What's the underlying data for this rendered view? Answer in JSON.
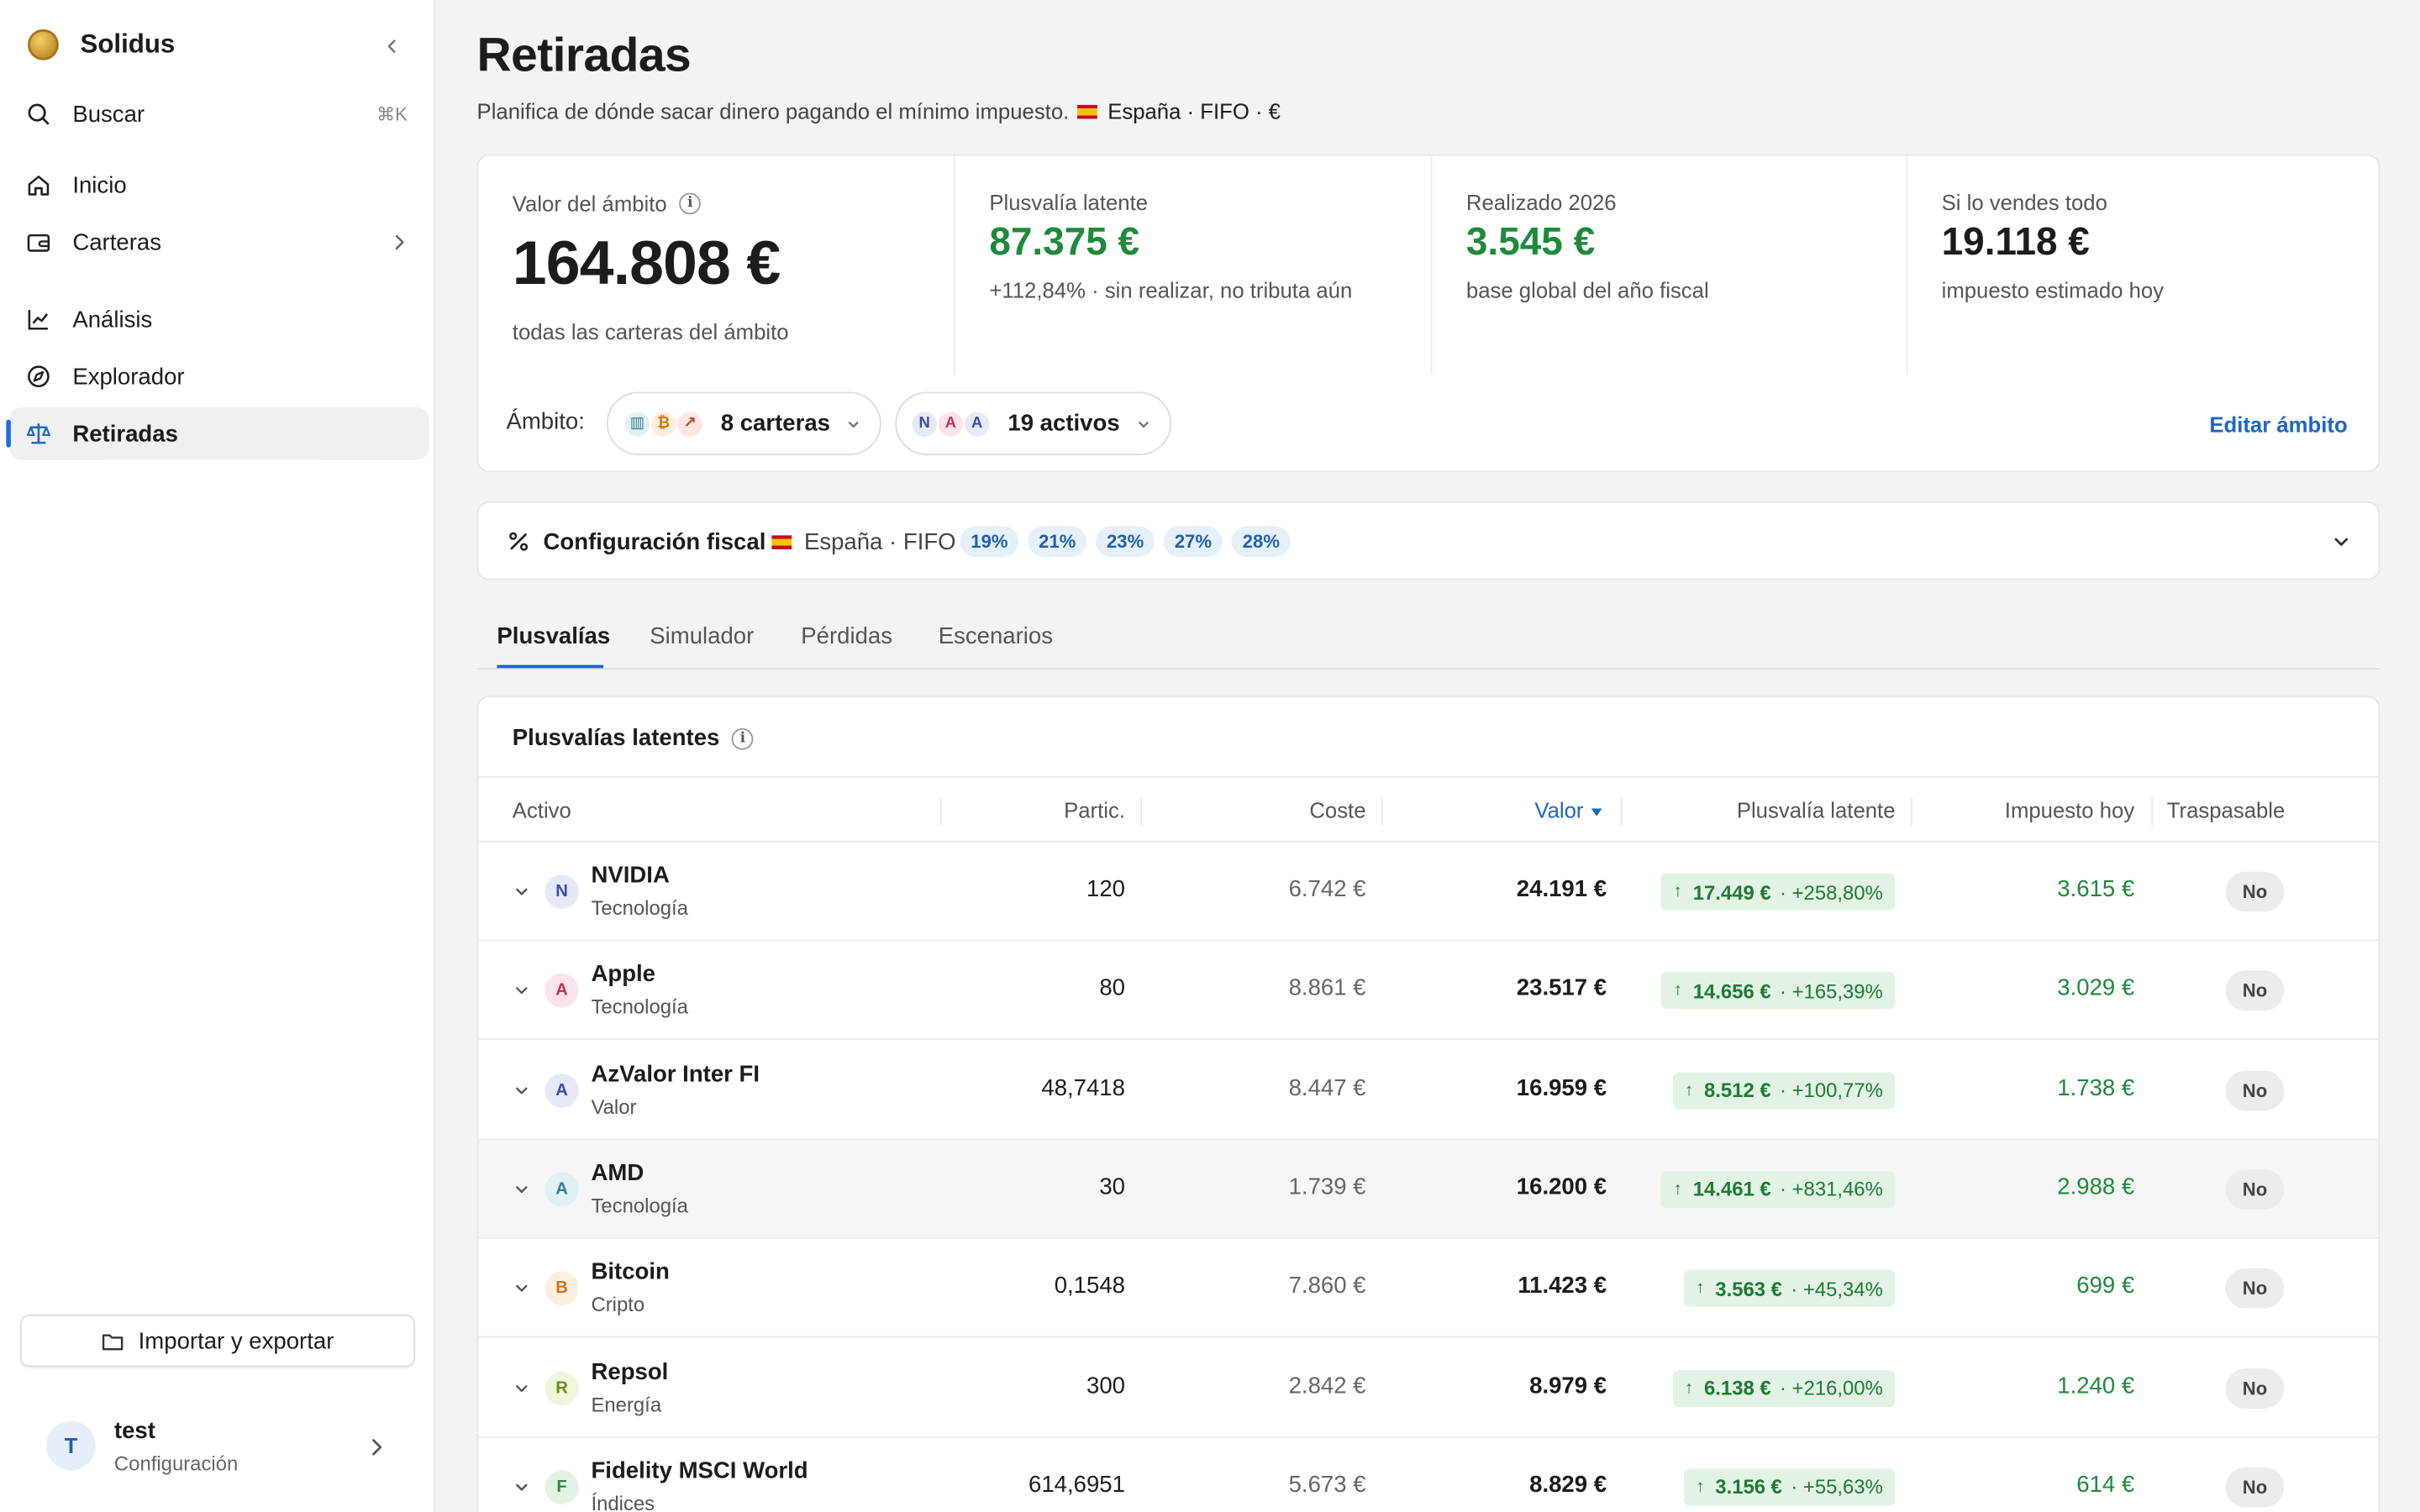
{
  "sidebar": {
    "brand": "Solidus",
    "search": {
      "label": "Buscar",
      "shortcut": "⌘K"
    },
    "nav": [
      {
        "label": "Inicio",
        "icon": "home-icon"
      },
      {
        "label": "Carteras",
        "icon": "wallet-icon"
      },
      {
        "label": "Análisis",
        "icon": "chart-line-icon"
      },
      {
        "label": "Explorador",
        "icon": "compass-icon"
      },
      {
        "label": "Retiradas",
        "icon": "scale-icon",
        "active": true
      }
    ],
    "import_label": "Importar y exportar",
    "user": {
      "initial": "T",
      "name": "test",
      "sub": "Configuración"
    }
  },
  "header": {
    "title": "Retiradas",
    "subtitle": "Planifica de dónde sacar dinero pagando el mínimo impuesto.",
    "meta": "España · FIFO · €"
  },
  "stats": [
    {
      "label": "Valor del ámbito",
      "value": "164.808 €",
      "sub": "todas las carteras del ámbito"
    },
    {
      "label": "Plusvalía latente",
      "value": "87.375 €",
      "sub": "+112,84% · sin realizar, no tributa aún"
    },
    {
      "label": "Realizado 2026",
      "value": "3.545 €",
      "sub": "base global del año fiscal"
    },
    {
      "label": "Si lo vendes todo",
      "value": "19.118 €",
      "sub": "impuesto estimado hoy"
    }
  ],
  "scope": {
    "label": "Ámbito:",
    "carteras": "8 carteras",
    "activos": "19 activos",
    "activos_initials": [
      "N",
      "A",
      "A"
    ],
    "edit_label": "Editar ámbito"
  },
  "fiscal": {
    "title": "Configuración fiscal",
    "meta": "España · FIFO",
    "rates": [
      "19%",
      "21%",
      "23%",
      "27%",
      "28%"
    ]
  },
  "tabs": [
    "Plusvalías",
    "Simulador",
    "Pérdidas",
    "Escenarios"
  ],
  "table": {
    "title": "Plusvalías latentes",
    "columns": {
      "activo": "Activo",
      "partic": "Partic.",
      "coste": "Coste",
      "valor": "Valor",
      "plusvalia": "Plusvalía latente",
      "impuesto": "Impuesto hoy",
      "traspasable": "Traspasable"
    },
    "rows": [
      {
        "initial": "N",
        "name": "NVIDIA",
        "sector": "Tecnología",
        "partic": "120",
        "coste": "6.742 €",
        "valor": "24.191 €",
        "gain": "17.449 €",
        "gain_pct": "· +258,80%",
        "impuesto": "3.615 €",
        "traspasable": "No"
      },
      {
        "initial": "A",
        "name": "Apple",
        "sector": "Tecnología",
        "partic": "80",
        "coste": "8.861 €",
        "valor": "23.517 €",
        "gain": "14.656 €",
        "gain_pct": "· +165,39%",
        "impuesto": "3.029 €",
        "traspasable": "No"
      },
      {
        "initial": "A",
        "name": "AzValor Inter FI",
        "sector": "Valor",
        "partic": "48,7418",
        "coste": "8.447 €",
        "valor": "16.959 €",
        "gain": "8.512 €",
        "gain_pct": "· +100,77%",
        "impuesto": "1.738 €",
        "traspasable": "No"
      },
      {
        "initial": "A",
        "name": "AMD",
        "sector": "Tecnología",
        "partic": "30",
        "coste": "1.739 €",
        "valor": "16.200 €",
        "gain": "14.461 €",
        "gain_pct": "· +831,46%",
        "impuesto": "2.988 €",
        "traspasable": "No"
      },
      {
        "initial": "B",
        "name": "Bitcoin",
        "sector": "Cripto",
        "partic": "0,1548",
        "coste": "7.860 €",
        "valor": "11.423 €",
        "gain": "3.563 €",
        "gain_pct": "· +45,34%",
        "impuesto": "699 €",
        "traspasable": "No"
      },
      {
        "initial": "R",
        "name": "Repsol",
        "sector": "Energía",
        "partic": "300",
        "coste": "2.842 €",
        "valor": "8.979 €",
        "gain": "6.138 €",
        "gain_pct": "· +216,00%",
        "impuesto": "1.240 €",
        "traspasable": "No"
      },
      {
        "initial": "F",
        "name": "Fidelity MSCI World",
        "sector": "Índices",
        "partic": "614,6951",
        "coste": "5.673 €",
        "valor": "8.829 €",
        "gain": "3.156 €",
        "gain_pct": "· +55,63%",
        "impuesto": "614 €",
        "traspasable": "No"
      }
    ]
  },
  "colors": {
    "accent": "#1d66c4",
    "positive": "#1f8a3b",
    "positive_bg": "#e2f3e5"
  }
}
